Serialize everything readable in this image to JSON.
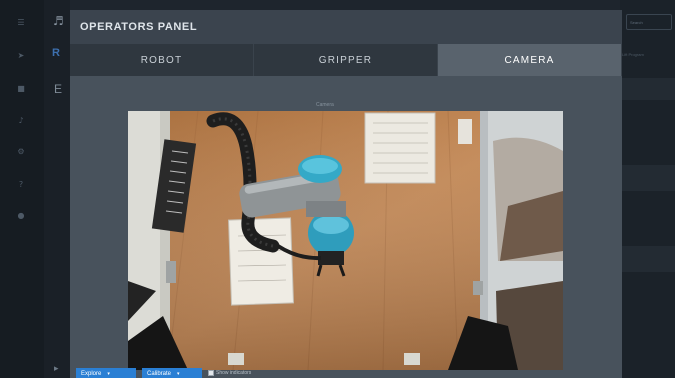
{
  "background": {
    "rail_icons": [
      "menu-icon",
      "arrow-icon",
      "list-icon",
      "music-icon",
      "gear-icon",
      "help-icon",
      "lock-icon"
    ],
    "search_placeholder": "Search",
    "right_strip_text": "Lift Program",
    "left_letter_1": "R",
    "left_letter_2": "E"
  },
  "modal": {
    "title": "OPERATORS PANEL",
    "tabs": [
      {
        "label": "ROBOT",
        "active": false
      },
      {
        "label": "GRIPPER",
        "active": false
      },
      {
        "label": "CAMERA",
        "active": true
      }
    ],
    "camera_caption": "Camera",
    "footer": {
      "button_1": "Explore",
      "button_2": "Calibrate",
      "checkbox_label": "Show indicators"
    }
  },
  "colors": {
    "accent": "#2a7fd4",
    "header_bg": "#3b444e",
    "tab_active_bg": "#59636d",
    "tab_bg": "#2f373f",
    "robot_accent": "#34a9c7"
  }
}
